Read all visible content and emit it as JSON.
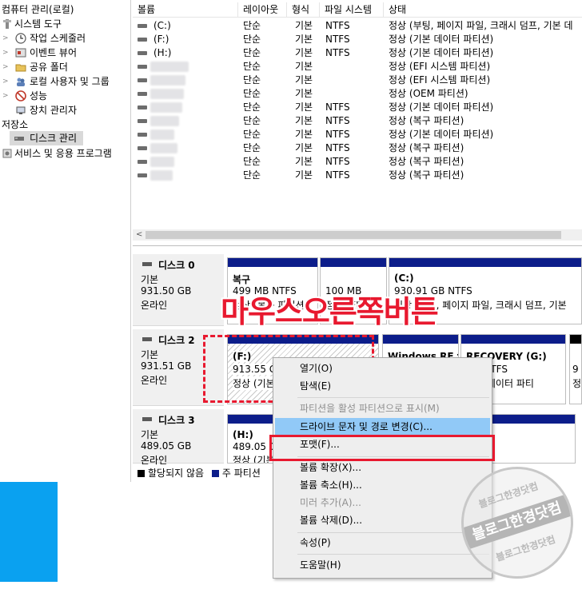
{
  "tree": {
    "items": [
      {
        "label": "컴퓨터 관리(로컬)",
        "indent": 0
      },
      {
        "label": "시스템 도구",
        "indent": 1
      },
      {
        "label": "작업 스케줄러",
        "indent": 2
      },
      {
        "label": "이벤트 뷰어",
        "indent": 2
      },
      {
        "label": "공유 폴더",
        "indent": 2
      },
      {
        "label": "로컬 사용자 및 그룹",
        "indent": 2
      },
      {
        "label": "성능",
        "indent": 2
      },
      {
        "label": "장치 관리자",
        "indent": 2
      },
      {
        "label": "저장소",
        "indent": 1
      },
      {
        "label": "디스크 관리",
        "indent": 2
      },
      {
        "label": "서비스 및 응용 프로그램",
        "indent": 1
      }
    ]
  },
  "volumes": {
    "headers": [
      "볼륨",
      "레이아웃",
      "형식",
      "파일 시스템",
      "상태"
    ],
    "rows": [
      {
        "volume": "(C:)",
        "layout": "단순",
        "type": "기본",
        "fs": "NTFS",
        "status": "정상 (부팅, 페이지 파일, 크래시 덤프, 기본 데"
      },
      {
        "volume": "(F:)",
        "layout": "단순",
        "type": "기본",
        "fs": "NTFS",
        "status": "정상 (기본 데이터 파티션)"
      },
      {
        "volume": "(H:)",
        "layout": "단순",
        "type": "기본",
        "fs": "NTFS",
        "status": "정상 (기본 데이터 파티션)"
      },
      {
        "volume": "",
        "layout": "단순",
        "type": "기본",
        "fs": "",
        "status": "정상 (EFI 시스템 파티션)"
      },
      {
        "volume": "",
        "layout": "단순",
        "type": "기본",
        "fs": "",
        "status": "정상 (EFI 시스템 파티션)"
      },
      {
        "volume": "",
        "layout": "단순",
        "type": "기본",
        "fs": "",
        "status": "정상 (OEM 파티션)"
      },
      {
        "volume": "",
        "layout": "단순",
        "type": "기본",
        "fs": "NTFS",
        "status": "정상 (기본 데이터 파티션)"
      },
      {
        "volume": "",
        "layout": "단순",
        "type": "기본",
        "fs": "NTFS",
        "status": "정상 (복구 파티션)"
      },
      {
        "volume": "",
        "layout": "단순",
        "type": "기본",
        "fs": "NTFS",
        "status": "정상 (기본 데이터 파티션)"
      },
      {
        "volume": "",
        "layout": "단순",
        "type": "기본",
        "fs": "NTFS",
        "status": "정상 (복구 파티션)"
      },
      {
        "volume": "",
        "layout": "단순",
        "type": "기본",
        "fs": "NTFS",
        "status": "정상 (복구 파티션)"
      },
      {
        "volume": "",
        "layout": "단순",
        "type": "기본",
        "fs": "NTFS",
        "status": "정상 (복구 파티션)"
      }
    ]
  },
  "disks": {
    "disk0": {
      "name": "디스크 0",
      "kind": "기본",
      "size": "931.50 GB",
      "state": "온라인",
      "parts": [
        {
          "title": "복구",
          "size": "499 MB NTFS",
          "status": "정상 (복구 파티션)"
        },
        {
          "title": "",
          "size": "100 MB",
          "status": "정상 (EFI"
        },
        {
          "title": "(C:)",
          "size": "930.91 GB NTFS",
          "status": "정상 (부팅, 페이지 파일, 크래시 덤프, 기본"
        }
      ]
    },
    "disk2": {
      "name": "디스크 2",
      "kind": "기본",
      "size": "931.51 GB",
      "state": "온라인",
      "parts": [
        {
          "title": "(F:)",
          "size": "913.55 G",
          "status": "정상 (기본"
        },
        {
          "title": "Windows RE t",
          "size": "",
          "status": ""
        },
        {
          "title": "RECOVERY  (G:)",
          "size": "GB NTFS",
          "status": "기본 데이터 파티"
        },
        {
          "title": "",
          "size": "9",
          "status": "정"
        }
      ]
    },
    "disk3": {
      "name": "디스크 3",
      "kind": "기본",
      "size": "489.05 GB",
      "state": "온라인",
      "parts": [
        {
          "title": "(H:)",
          "size": "489.05 G",
          "status": "정상 (기본"
        }
      ]
    },
    "legend": {
      "unallocated": "할당되지 않음",
      "primary": "주 파티션"
    }
  },
  "context_menu": {
    "items": [
      {
        "label": "열기(O)",
        "enabled": true
      },
      {
        "label": "탐색(E)",
        "enabled": true
      },
      {
        "label": "파티션을 활성 파티션으로 표시(M)",
        "enabled": false
      },
      {
        "label": "드라이브 문자 및 경로 변경(C)...",
        "enabled": true,
        "highlighted": true
      },
      {
        "label": "포맷(F)...",
        "enabled": true
      },
      {
        "label": "볼륨 확장(X)...",
        "enabled": true
      },
      {
        "label": "볼륨 축소(H)...",
        "enabled": true
      },
      {
        "label": "미러 추가(A)...",
        "enabled": false
      },
      {
        "label": "볼륨 삭제(D)...",
        "enabled": true
      },
      {
        "label": "속성(P)",
        "enabled": true
      },
      {
        "label": "도움말(H)",
        "enabled": true
      }
    ]
  },
  "annotation": {
    "text": "마우스오른쪽버튼"
  },
  "watermark": {
    "top": "블로그한경닷컴",
    "main": "블로그한경닷컴",
    "bottom": "블로그한경닷컴"
  },
  "colors": {
    "primary_partition": "#0c1d8a",
    "annotation": "#e8192f",
    "highlight": "#91c9f7",
    "taskbar_accent": "#0aa1f0"
  }
}
